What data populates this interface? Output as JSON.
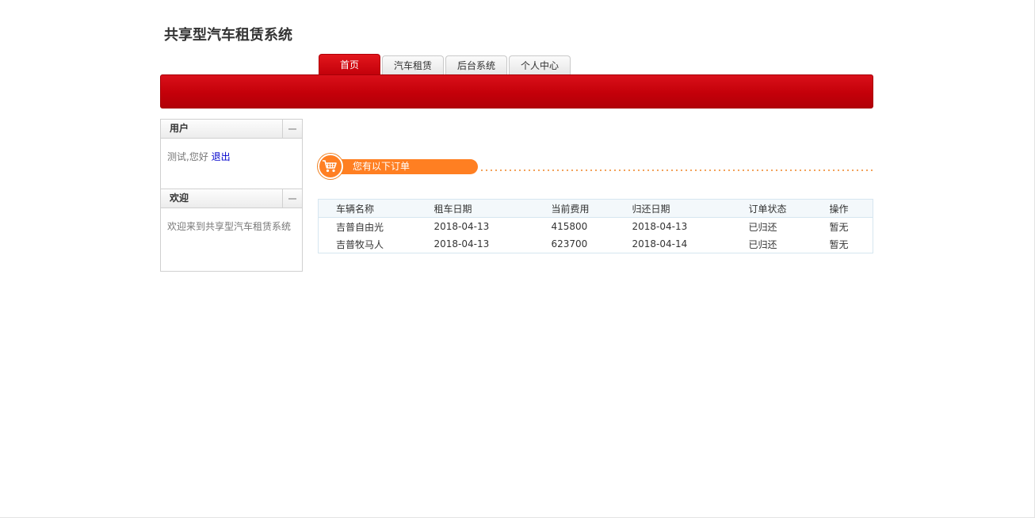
{
  "site": {
    "title": "共享型汽车租赁系统"
  },
  "nav": {
    "tabs": [
      {
        "label": "首页",
        "active": true
      },
      {
        "label": "汽车租赁",
        "active": false
      },
      {
        "label": "后台系统",
        "active": false
      },
      {
        "label": "个人中心",
        "active": false
      }
    ]
  },
  "sidebar": {
    "user_panel": {
      "title": "用户",
      "greeting": "测试,您好",
      "logout_label": "退出"
    },
    "welcome_panel": {
      "title": "欢迎",
      "message": "欢迎来到共享型汽车租赁系统"
    }
  },
  "orders": {
    "heading": "您有以下订单",
    "icon": "shopping-cart-icon",
    "columns": [
      "车辆名称",
      "租车日期",
      "当前费用",
      "归还日期",
      "订单状态",
      "操作"
    ],
    "rows": [
      [
        "吉普自由光",
        "2018-04-13",
        "415800",
        "2018-04-13",
        "已归还",
        "暂无"
      ],
      [
        "吉普牧马人",
        "2018-04-13",
        "623700",
        "2018-04-14",
        "已归还",
        "暂无"
      ]
    ]
  },
  "colors": {
    "brand_red": "#c40009",
    "accent_orange": "#ff7f22",
    "link_blue": "#0000cc"
  }
}
